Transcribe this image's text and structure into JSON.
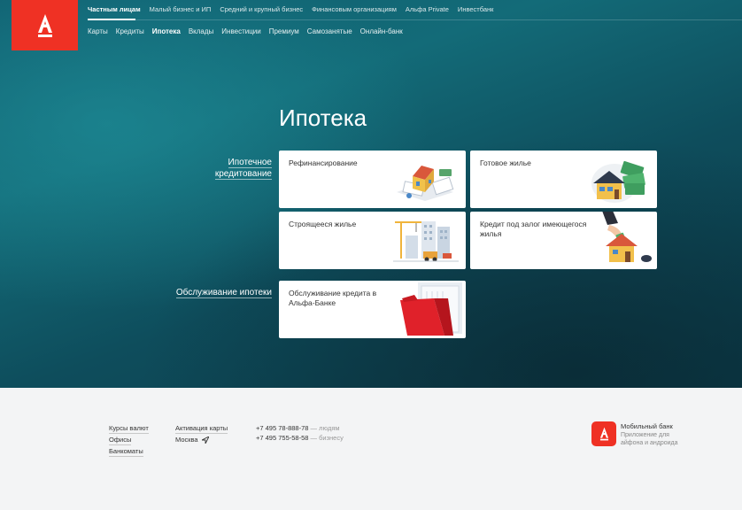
{
  "brand": {
    "accent": "#ef3124",
    "logo_icon": "alfa-logo-icon"
  },
  "nav_top": {
    "items": [
      "Частным лицам",
      "Малый бизнес и ИП",
      "Средний и крупный бизнес",
      "Финансовым организациям",
      "Альфа Private",
      "Инвестбанк"
    ],
    "active_index": 0
  },
  "nav_sub": {
    "items": [
      "Карты",
      "Кредиты",
      "Ипотека",
      "Вклады",
      "Инвестиции",
      "Премиум",
      "Самозанятые",
      "Онлайн-банк"
    ],
    "active_index": 2
  },
  "page_title": "Ипотека",
  "sections": [
    {
      "label": "Ипотечное кредитование",
      "cards": [
        {
          "label": "Рефинансирование",
          "icon": "house-documents-icon"
        },
        {
          "label": "Готовое жилье",
          "icon": "house-money-icon"
        },
        {
          "label": "Строящееся жилье",
          "icon": "construction-crane-icon"
        },
        {
          "label": "Кредит под залог имеющегося жилья",
          "icon": "house-hand-icon"
        }
      ]
    },
    {
      "label": "Обслуживание ипотеки",
      "cards": [
        {
          "label": "Обслуживание кредита в Альфа-Банке",
          "icon": "red-folder-icon"
        }
      ]
    }
  ],
  "footer": {
    "links_col1": [
      "Курсы валют",
      "Офисы",
      "Банкоматы"
    ],
    "links_col2": [
      "Активация карты",
      "Москва"
    ],
    "location_icon": "location-arrow-icon",
    "phones": [
      {
        "number": "+7 495 78-888-78",
        "note": "— людям"
      },
      {
        "number": "+7 495 755-58-58",
        "note": "— бизнесу"
      }
    ],
    "mobile_app": {
      "title": "Мобильный банк",
      "desc": "Приложение для айфона и андроида",
      "icon": "alfa-app-icon"
    }
  }
}
